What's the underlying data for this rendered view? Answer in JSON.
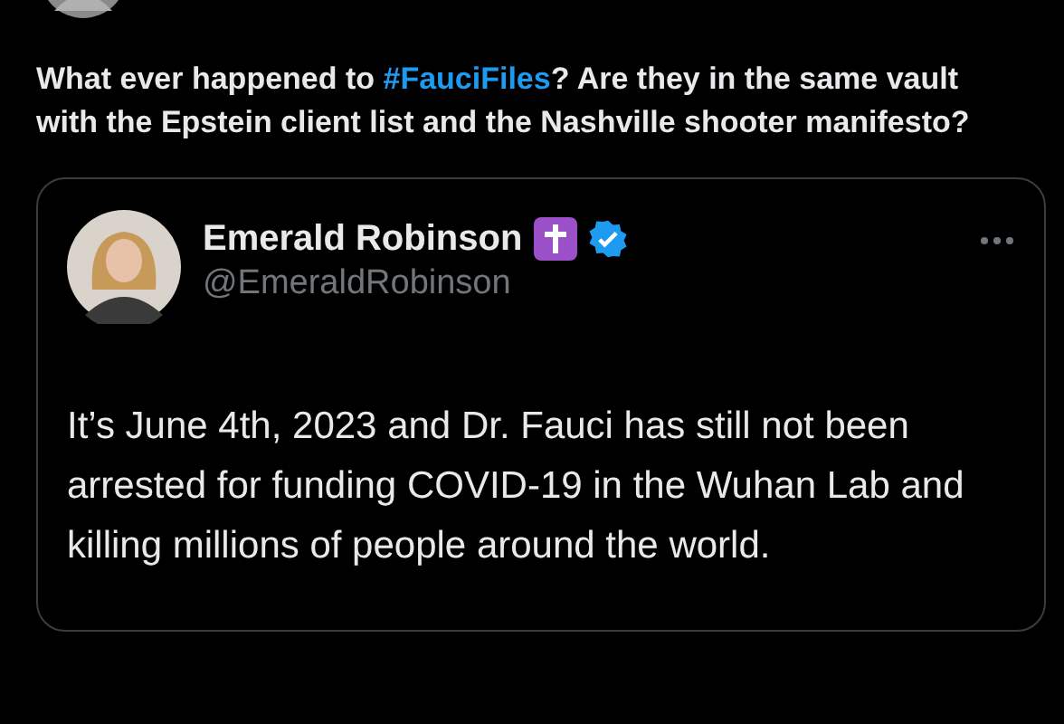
{
  "post": {
    "text_parts": [
      {
        "kind": "text",
        "text": "What ever happened to "
      },
      {
        "kind": "hashtag",
        "text": "#FauciFiles"
      },
      {
        "kind": "text",
        "text": "? Are they in the same vault with the Epstein client list and the Nashville shooter manifesto?"
      }
    ]
  },
  "quoted_post": {
    "name": "Emerald Robinson",
    "verified": true,
    "handle": "@EmeraldRobinson",
    "text": "It’s June 4th, 2023 and Dr. Fauci has still not been arrested for funding COVID-19 in the Wuhan Lab and killing millions of people around the world."
  }
}
